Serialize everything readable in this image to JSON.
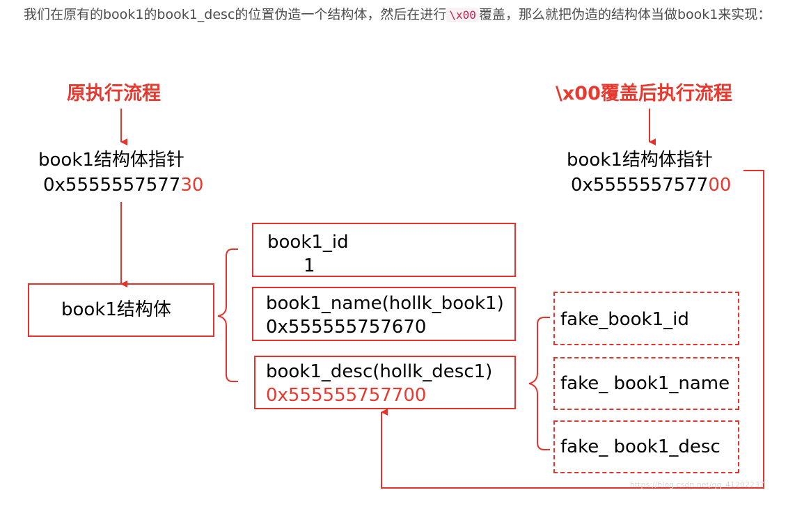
{
  "intro": {
    "before_code": "我们在原有的book1的book1_desc的位置伪造一个结构体，然后在进行",
    "code": "\\x00",
    "after_code": "覆盖，那么就把伪造的结构体当做book1来实现："
  },
  "left": {
    "title": "原执行流程",
    "pointer_label": "book1结构体指针",
    "pointer_prefix": "0x5555557577",
    "pointer_suffix": "30",
    "struct_label": "book1结构体"
  },
  "right": {
    "title": "\\x00覆盖后执行流程",
    "pointer_label": "book1结构体指针",
    "pointer_prefix": "0x5555557577",
    "pointer_suffix": "00"
  },
  "fields": {
    "id_name": "book1_id",
    "id_value": "1",
    "name_name": "book1_name(hollk_book1)",
    "name_value": "0x555555757670",
    "desc_name": "book1_desc(hollk_desc1)",
    "desc_value": "0x555555757700"
  },
  "fake": {
    "id": "fake_book1_id",
    "name": "fake_ book1_name",
    "desc": "fake_ book1_desc"
  },
  "watermark": "https://blog.csdn.net/qq_41202237",
  "colors": {
    "accent": "#e3332b",
    "text": "#000000",
    "intro_text": "#4d4d4d"
  }
}
